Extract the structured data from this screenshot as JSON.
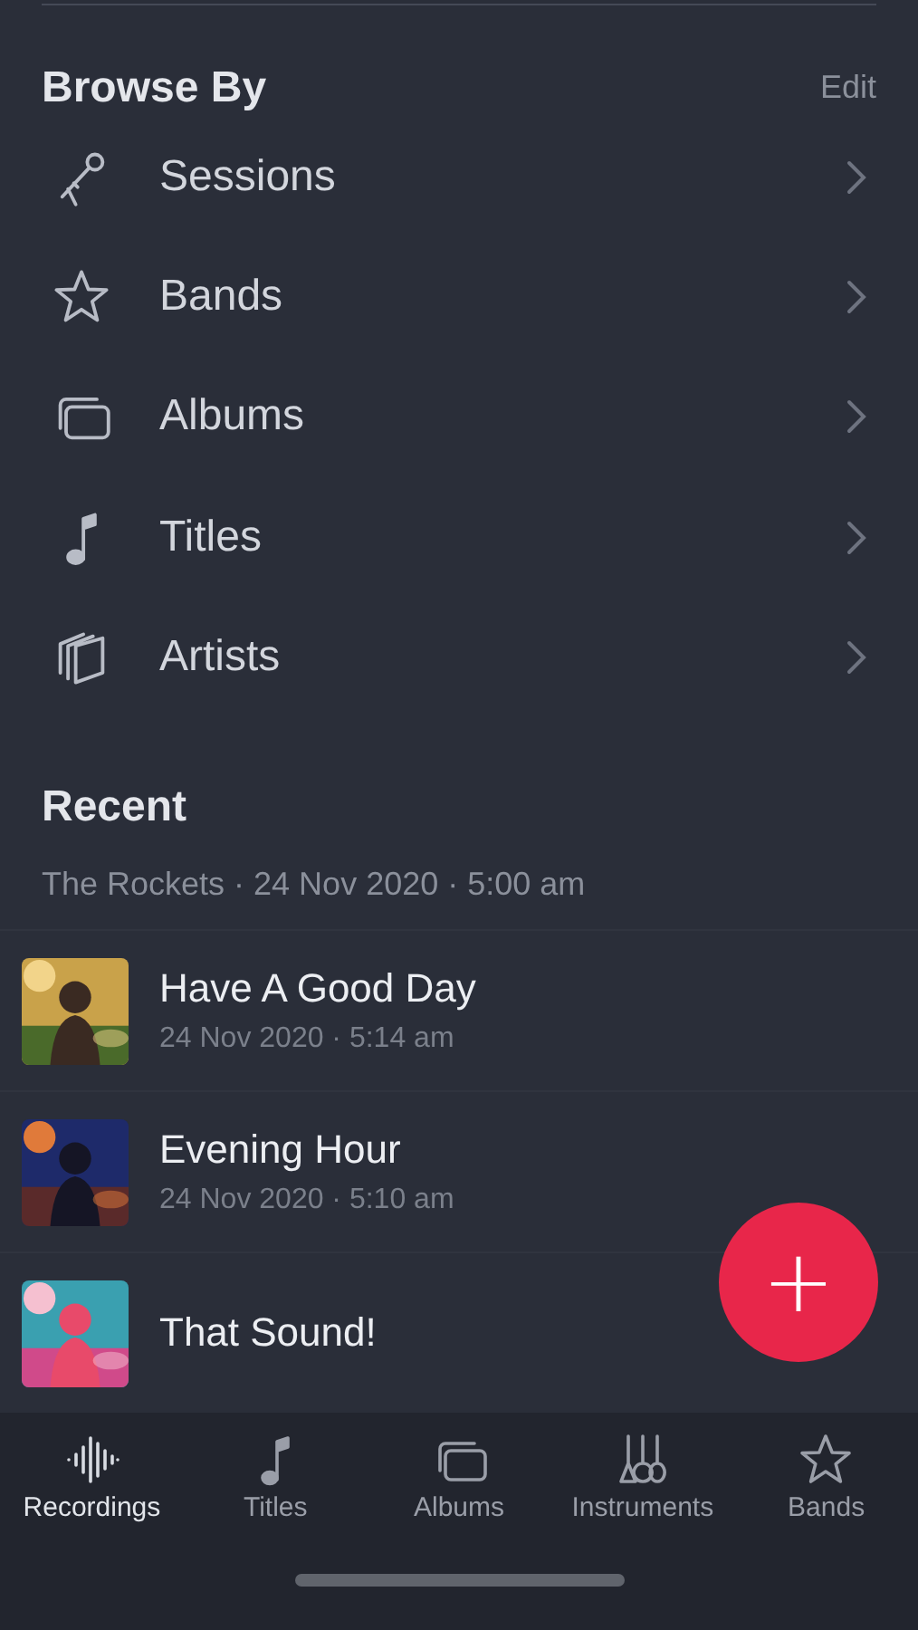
{
  "browse": {
    "title": "Browse By",
    "edit": "Edit",
    "items": [
      {
        "label": "Sessions",
        "kind": "mic"
      },
      {
        "label": "Bands",
        "kind": "star"
      },
      {
        "label": "Albums",
        "kind": "albums"
      },
      {
        "label": "Titles",
        "kind": "note"
      },
      {
        "label": "Artists",
        "kind": "artists"
      }
    ]
  },
  "recent": {
    "title": "Recent",
    "subtitle": "The Rockets · 24 Nov 2020 · 5:00 am",
    "items": [
      {
        "title": "Have A Good Day",
        "meta": "24 Nov 2020 · 5:14 am"
      },
      {
        "title": "Evening Hour",
        "meta": "24 Nov 2020 · 5:10 am"
      },
      {
        "title": "That Sound!"
      }
    ]
  },
  "add_button": {
    "label": "+"
  },
  "tab_bar": [
    {
      "label": "Recordings",
      "kind": "wave",
      "selected": true
    },
    {
      "label": "Titles",
      "kind": "note",
      "selected": false
    },
    {
      "label": "Albums",
      "kind": "albums",
      "selected": false
    },
    {
      "label": "Instruments",
      "kind": "instruments",
      "selected": false
    },
    {
      "label": "Bands",
      "kind": "star",
      "selected": false
    }
  ]
}
